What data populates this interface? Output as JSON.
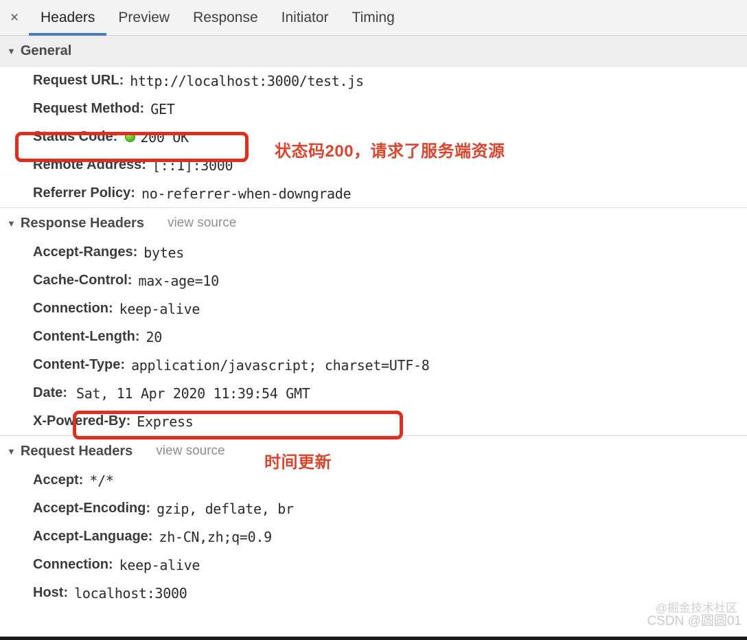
{
  "tabbar": {
    "close_icon": "close-icon",
    "close_glyph": "×",
    "tabs": [
      {
        "label": "Headers",
        "active": true
      },
      {
        "label": "Preview",
        "active": false
      },
      {
        "label": "Response",
        "active": false
      },
      {
        "label": "Initiator",
        "active": false
      },
      {
        "label": "Timing",
        "active": false
      }
    ],
    "active_underline_color": "#4a7cb5"
  },
  "sections": {
    "general": {
      "title": "General",
      "caret": "▼",
      "rows": [
        {
          "name": "Request URL:",
          "value": "http://localhost:3000/test.js"
        },
        {
          "name": "Request Method:",
          "value": "GET"
        },
        {
          "name": "Status Code:",
          "value": "200 OK",
          "status_dot": true
        },
        {
          "name": "Remote Address:",
          "value": "[::1]:3000"
        },
        {
          "name": "Referrer Policy:",
          "value": "no-referrer-when-downgrade"
        }
      ]
    },
    "response_headers": {
      "title": "Response Headers",
      "caret": "▼",
      "view_source": "view source",
      "rows": [
        {
          "name": "Accept-Ranges:",
          "value": "bytes"
        },
        {
          "name": "Cache-Control:",
          "value": "max-age=10"
        },
        {
          "name": "Connection:",
          "value": "keep-alive"
        },
        {
          "name": "Content-Length:",
          "value": "20"
        },
        {
          "name": "Content-Type:",
          "value": "application/javascript; charset=UTF-8"
        },
        {
          "name": "Date:",
          "value": "Sat, 11 Apr 2020 11:39:54 GMT"
        },
        {
          "name": "X-Powered-By:",
          "value": "Express"
        }
      ]
    },
    "request_headers": {
      "title": "Request Headers",
      "caret": "▼",
      "view_source": "view source",
      "rows": [
        {
          "name": "Accept:",
          "value": "*/*"
        },
        {
          "name": "Accept-Encoding:",
          "value": "gzip, deflate, br"
        },
        {
          "name": "Accept-Language:",
          "value": "zh-CN,zh;q=0.9"
        },
        {
          "name": "Connection:",
          "value": "keep-alive"
        },
        {
          "name": "Host:",
          "value": "localhost:3000"
        }
      ]
    }
  },
  "annotations": {
    "status_note": "状态码200，请求了服务端资源",
    "date_note": "时间更新",
    "highlight_color": "#dd2f1f"
  },
  "watermarks": {
    "juejin": "@掘金技术社区",
    "csdn": "CSDN @圆圆01"
  }
}
